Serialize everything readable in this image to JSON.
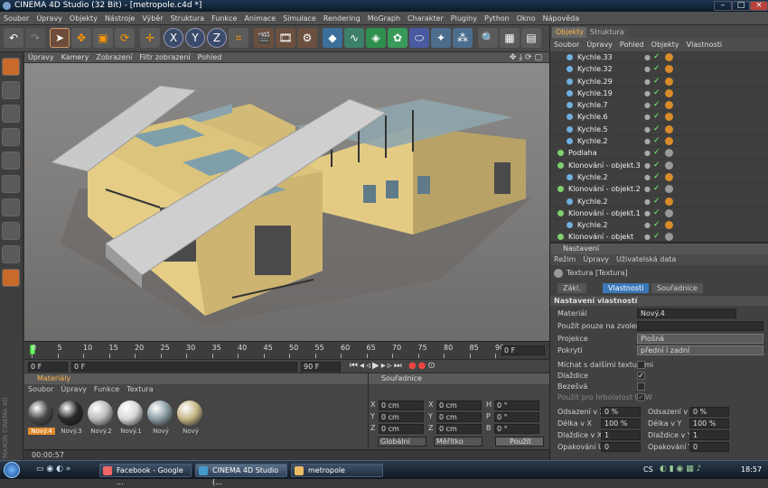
{
  "window": {
    "title": "CINEMA 4D Studio (32 Bit) - [metropole.c4d *]"
  },
  "menu": [
    "Soubor",
    "Úpravy",
    "Objekty",
    "Nástroje",
    "Výběr",
    "Struktura",
    "Funkce",
    "Animace",
    "Simulace",
    "Rendering",
    "MoGraph",
    "Charakter",
    "Pluginy",
    "Python",
    "Okno",
    "Nápověda"
  ],
  "viewport": {
    "menu": [
      "Úpravy",
      "Kamery",
      "Zobrazení",
      "Filtr zobrazení",
      "Pohled"
    ]
  },
  "timeline": {
    "ticks": [
      "0",
      "5",
      "10",
      "15",
      "20",
      "25",
      "30",
      "35",
      "40",
      "45",
      "50",
      "55",
      "60",
      "65",
      "70",
      "75",
      "80",
      "85",
      "90"
    ],
    "end_frame": "0 F"
  },
  "transport": {
    "start": "0 F",
    "current": "0 F",
    "end_field": "90 F",
    "max": "90 F"
  },
  "materials": {
    "title": "Materiály",
    "menu": [
      "Soubor",
      "Úpravy",
      "Funkce",
      "Textura"
    ],
    "items": [
      {
        "name": "Nový.4",
        "color": "#4b4b4b",
        "selected": true
      },
      {
        "name": "Nový.3",
        "color": "#2a2a2a",
        "selected": false
      },
      {
        "name": "Nový.2",
        "color": "#bdbdbd",
        "selected": false
      },
      {
        "name": "Nový.1",
        "color": "#d8d8d8",
        "selected": false
      },
      {
        "name": "Nový",
        "color": "#8fa0a8",
        "selected": false
      },
      {
        "name": "Nový",
        "color": "#c8b889",
        "selected": false
      }
    ]
  },
  "coords": {
    "title": "Souřadnice",
    "rows": [
      {
        "a": "X",
        "av": "0 cm",
        "b": "X",
        "bv": "0 cm",
        "c": "H",
        "cv": "0 °"
      },
      {
        "a": "Y",
        "av": "0 cm",
        "b": "Y",
        "bv": "0 cm",
        "c": "P",
        "cv": "0 °"
      },
      {
        "a": "Z",
        "av": "0 cm",
        "b": "Z",
        "bv": "0 cm",
        "c": "B",
        "cv": "0 °"
      }
    ],
    "dropdown1": "Globální",
    "dropdown2": "Měřítko",
    "apply": "Použít"
  },
  "status": {
    "time": "00:00:57"
  },
  "objects": {
    "tabs": [
      "Objekty",
      "Struktura"
    ],
    "menu": [
      "Soubor",
      "Úpravy",
      "Pohled",
      "Objekty",
      "Vlastnosti"
    ],
    "rows": [
      {
        "name": "Kychle.33",
        "indent": 1
      },
      {
        "name": "Kychle.32",
        "indent": 1
      },
      {
        "name": "Kychle.29",
        "indent": 1
      },
      {
        "name": "Kychle.19",
        "indent": 1
      },
      {
        "name": "Kychle.7",
        "indent": 1
      },
      {
        "name": "Kychle.6",
        "indent": 1
      },
      {
        "name": "Kychle.5",
        "indent": 1
      },
      {
        "name": "Kychle.2",
        "indent": 1
      },
      {
        "name": "Podlaha",
        "indent": 0
      },
      {
        "name": "Klonování - objekt.3",
        "indent": 0
      },
      {
        "name": "Kychle.2",
        "indent": 1
      },
      {
        "name": "Klonování - objekt.2",
        "indent": 0
      },
      {
        "name": "Kychle.2",
        "indent": 1
      },
      {
        "name": "Klonování - objekt.1",
        "indent": 0
      },
      {
        "name": "Kychle.2",
        "indent": 1
      },
      {
        "name": "Klonování - objekt",
        "indent": 0
      }
    ]
  },
  "attributes": {
    "title": "Nastavení",
    "menu": [
      "Režim",
      "Úpravy",
      "Uživatelská data"
    ],
    "object": "Textura [Textura]",
    "tabs": [
      "Zákl.",
      "Vlastnosti",
      "Souřadnice"
    ],
    "section": "Nastavení vlastností",
    "material_label": "Materiál",
    "material_value": "Nový.4",
    "use_only_label": "Použít pouze na zvolené",
    "projection_label": "Projekce",
    "projection_value": "Plošná",
    "cover_label": "Pokrytí",
    "cover_value": "přední i zadní",
    "mix_label": "Míchat s dalšími texturami",
    "tile_label": "Dlaždice",
    "seamless_label": "Bezešvá",
    "uvw_label": "Použít pro hrbolatost UVW",
    "offset_u_label": "Odsazení v X",
    "offset_u": "0 %",
    "offset_v_label": "Odsazení v Y",
    "offset_v": "0 %",
    "length_u_label": "Délka v X",
    "length_u": "100 %",
    "length_v_label": "Délka v Y",
    "length_v": "100 %",
    "tiles_u_label": "Dlaždice v X",
    "tiles_u": "1",
    "tiles_v_label": "Dlaždice v Y",
    "tiles_v": "1",
    "repeat_u_label": "Opakování U",
    "repeat_u": "0",
    "repeat_v_label": "Opakování V",
    "repeat_v": "0"
  },
  "taskbar": {
    "items": [
      "Facebook - Google ...",
      "CINEMA 4D Studio (...",
      "metropole"
    ],
    "lang": "CS",
    "clock": "18:57"
  },
  "brand": "MAXON CINEMA 4D"
}
